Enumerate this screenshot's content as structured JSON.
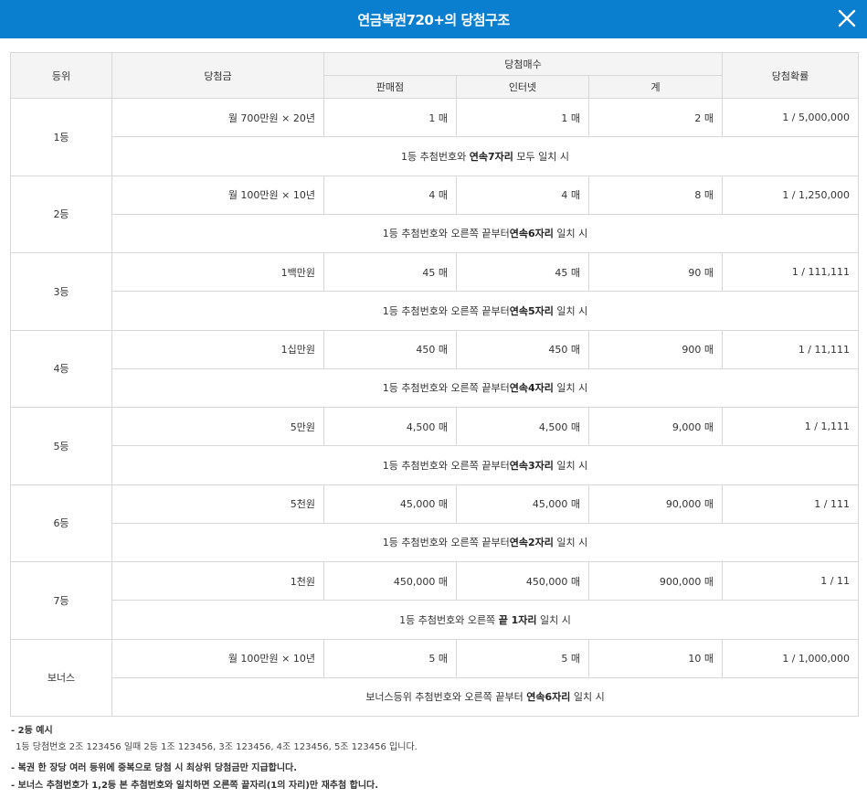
{
  "header": {
    "title": "연금복권720+의 당첨구조",
    "close_icon": "close-icon"
  },
  "colors": {
    "header_bg": "#0a7fcf",
    "table_header_bg": "#f4f4f4",
    "border": "#d8d8d8"
  },
  "table": {
    "headers": {
      "rank": "등위",
      "amount": "당첨금",
      "count_group": "당첨매수",
      "store": "판매점",
      "internet": "인터넷",
      "total": "계",
      "probability": "당첨확률"
    },
    "rows": [
      {
        "rank": "1등",
        "amount": "월 700만원 × 20년",
        "store": "1 매",
        "internet": "1 매",
        "total": "2 매",
        "prob": "1 / 5,000,000",
        "cond_pre": "1등 추첨번호와 ",
        "cond_bold": "연속7자리",
        "cond_post": " 모두 일치 시"
      },
      {
        "rank": "2등",
        "amount": "월 100만원 × 10년",
        "store": "4 매",
        "internet": "4 매",
        "total": "8 매",
        "prob": "1 / 1,250,000",
        "cond_pre": "1등 추첨번호와 오른쪽 끝부터",
        "cond_bold": "연속6자리",
        "cond_post": " 일치 시"
      },
      {
        "rank": "3등",
        "amount": "1백만원",
        "store": "45 매",
        "internet": "45 매",
        "total": "90 매",
        "prob": "1 / 111,111",
        "cond_pre": "1등 추첨번호와 오른쪽 끝부터",
        "cond_bold": "연속5자리",
        "cond_post": " 일치 시"
      },
      {
        "rank": "4등",
        "amount": "1십만원",
        "store": "450 매",
        "internet": "450 매",
        "total": "900 매",
        "prob": "1 / 11,111",
        "cond_pre": "1등 추첨번호와 오른쪽 끝부터",
        "cond_bold": "연속4자리",
        "cond_post": " 일치 시"
      },
      {
        "rank": "5등",
        "amount": "5만원",
        "store": "4,500 매",
        "internet": "4,500 매",
        "total": "9,000 매",
        "prob": "1 / 1,111",
        "cond_pre": "1등 추첨번호와 오른쪽 끝부터",
        "cond_bold": "연속3자리",
        "cond_post": " 일치 시"
      },
      {
        "rank": "6등",
        "amount": "5천원",
        "store": "45,000 매",
        "internet": "45,000 매",
        "total": "90,000 매",
        "prob": "1 / 111",
        "cond_pre": "1등 추첨번호와 오른쪽 끝부터",
        "cond_bold": "연속2자리",
        "cond_post": " 일치 시"
      },
      {
        "rank": "7등",
        "amount": "1천원",
        "store": "450,000 매",
        "internet": "450,000 매",
        "total": "900,000 매",
        "prob": "1 / 11",
        "cond_pre": "1등 추첨번호와 오른쪽 ",
        "cond_bold": "끝 1자리",
        "cond_post": " 일치 시"
      },
      {
        "rank": "보너스",
        "amount": "월 100만원 × 10년",
        "store": "5 매",
        "internet": "5 매",
        "total": "10 매",
        "prob": "1 / 1,000,000",
        "cond_pre": "보너스등위 추첨번호와 오른쪽 끝부터 ",
        "cond_bold": "연속6자리",
        "cond_post": " 일치 시"
      }
    ]
  },
  "notes": {
    "example_title": "- 2등 예시",
    "example_body": "1등 당첨번호 2조 123456 일때 2등 1조 123456, 3조 123456, 4조 123456, 5조 123456 입니다.",
    "note1": "- 복권 한 장당 여러 등위에 중복으로 당첨 시 최상위 당첨금만 지급합니다.",
    "note2": "- 보너스 추첨번호가 1,2등 본 추첨번호와 일치하면 오른쪽 끝자리(1의 자리)만 재추첨 합니다."
  }
}
